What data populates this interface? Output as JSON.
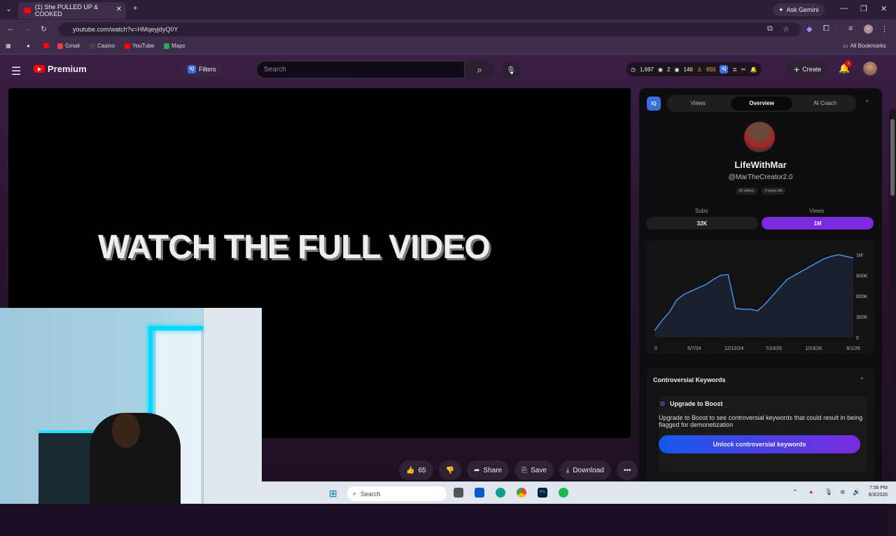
{
  "browser": {
    "tab_title": "(1) She PULLED UP & COOKED",
    "new_tab": "+",
    "ask_gemini": "Ask Gemini",
    "url": "youtube.com/watch?v=HMqeyjdyQ0Y",
    "bookmarks": [
      "Gmail",
      "Casino",
      "YouTube",
      "Maps"
    ],
    "all_bookmarks": "All Bookmarks"
  },
  "youtube": {
    "logo_text": "Premium",
    "filters": "Filters",
    "search_placeholder": "Search",
    "stats": {
      "views": "1,697",
      "watching": "2",
      "subs": "146",
      "points": "650"
    },
    "create": "Create",
    "notif_count": "1"
  },
  "video": {
    "overlay_text": "WATCH THE FULL VIDEO"
  },
  "actions": {
    "likes": "65",
    "share": "Share",
    "save": "Save",
    "download": "Download",
    "more": "•••"
  },
  "panel": {
    "iq": "IQ",
    "tabs": [
      "Views",
      "Overview",
      "AI Coach"
    ],
    "active_tab": "Overview",
    "channel_name": "LifeWithMar",
    "handle": "@MarTheCreator2.0",
    "chips": [
      "60 videos",
      "4 years old"
    ],
    "subs_label": "Subs",
    "subs_value": "32K",
    "views_label": "Views",
    "views_value": "1M",
    "keywords_title": "Controversial Keywords",
    "boost_title": "Upgrade to Boost",
    "boost_desc": "Upgrade to Boost to see controversial keywords that could result in being flagged for demonetization",
    "unlock": "Unlock controversial keywords"
  },
  "chart_data": {
    "type": "area",
    "x": [
      "0",
      "5/7/24",
      "12/12/24",
      "7/10/25",
      "1/23/26",
      "8/1/26"
    ],
    "y_ticks": [
      "1M",
      "900K",
      "600K",
      "300K",
      "0"
    ],
    "ylim": [
      0,
      1000000
    ],
    "series": [
      {
        "values": [
          80000,
          200000,
          300000,
          450000,
          520000,
          560000,
          600000,
          640000,
          700000,
          750000,
          760000,
          350000,
          340000,
          340000,
          320000,
          400000,
          500000,
          600000,
          700000,
          750000,
          800000,
          850000,
          900000,
          950000,
          980000,
          1000000,
          980000,
          960000
        ]
      }
    ]
  },
  "taskbar": {
    "search": "Search",
    "time": "7:56 PM",
    "date": "8/3/2026"
  },
  "colors": {
    "accent_purple": "#7a2be0",
    "accent_blue": "#1558e8",
    "chart_line": "#4a8fe8"
  }
}
